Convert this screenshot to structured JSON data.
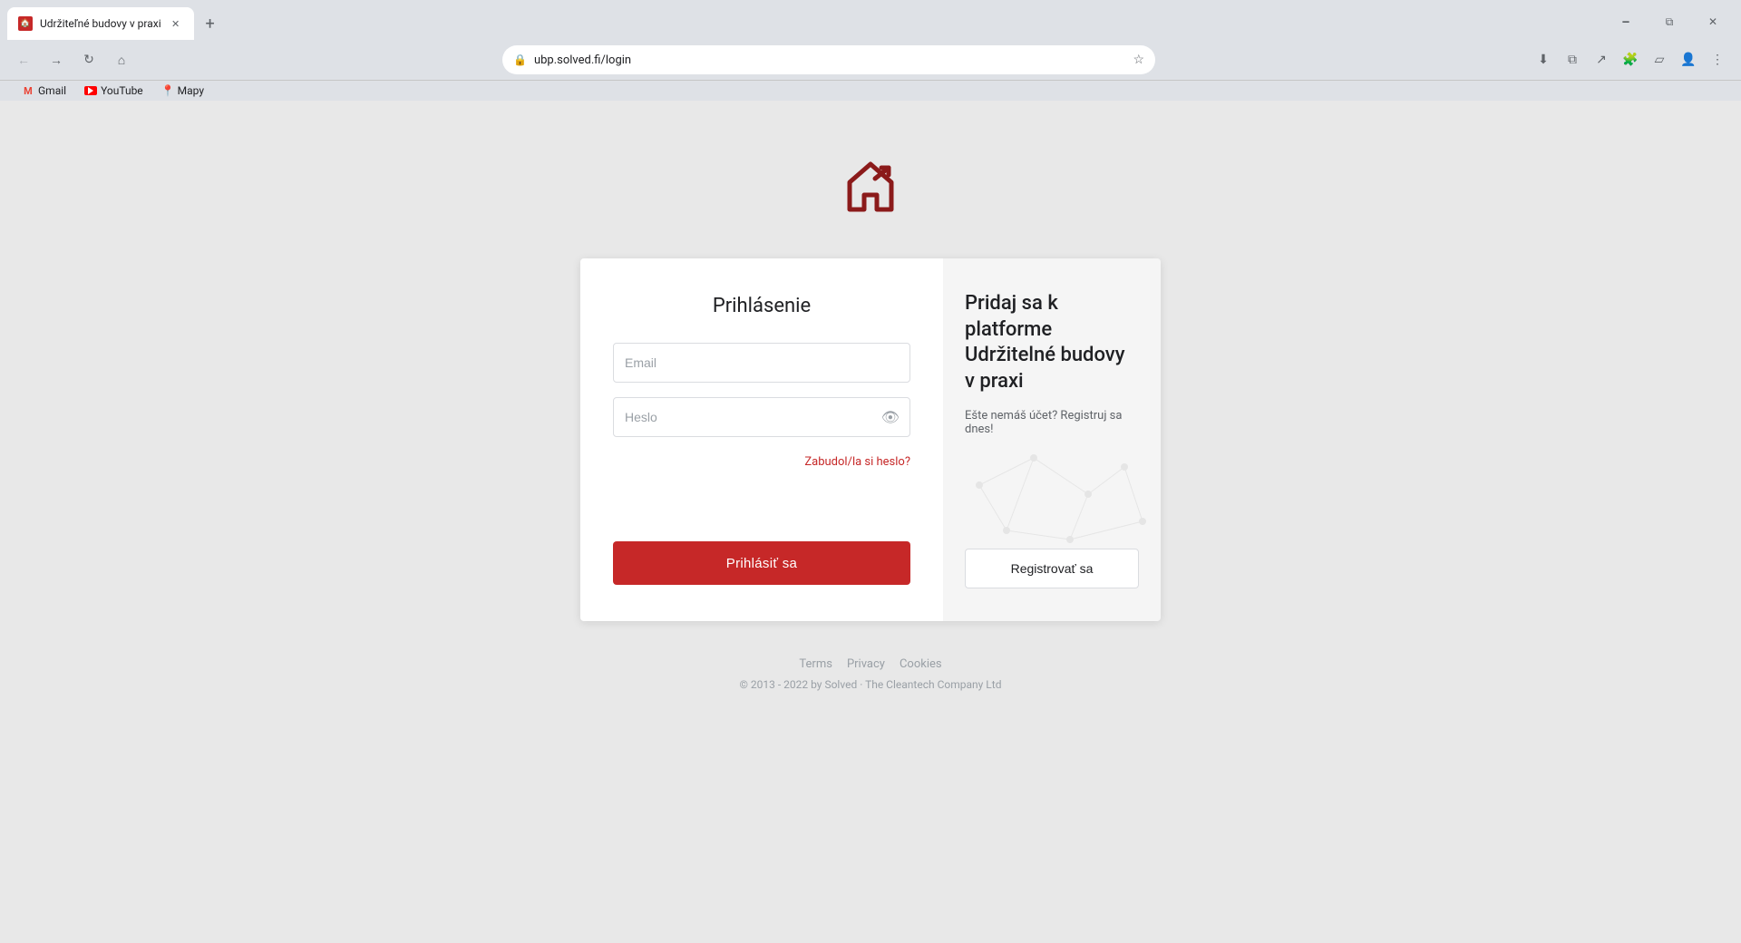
{
  "browser": {
    "tab": {
      "title": "Udržiteľné budovy v praxi",
      "favicon_color": "#c62828"
    },
    "address": "ubp.solved.fi/login",
    "bookmarks": [
      {
        "id": "gmail",
        "label": "Gmail",
        "type": "gmail"
      },
      {
        "id": "youtube",
        "label": "YouTube",
        "type": "youtube"
      },
      {
        "id": "mapy",
        "label": "Mapy",
        "type": "maps"
      }
    ],
    "window_controls": {
      "minimize": "🗕",
      "restore": "⧉",
      "close": "✕"
    }
  },
  "logo": {
    "alt": "UBP logo"
  },
  "login": {
    "title": "Prihlásenie",
    "email_placeholder": "Email",
    "password_placeholder": "Heslo",
    "forgot_label": "Zabudol/la si heslo?",
    "submit_label": "Prihlásiť sa"
  },
  "register": {
    "title": "Pridaj sa k platforme Udržitelné budovy v praxi",
    "subtitle": "Ešte nemáš účet? Registruj sa dnes!",
    "button_label": "Registrovať sa"
  },
  "footer": {
    "links": [
      {
        "id": "terms",
        "label": "Terms"
      },
      {
        "id": "privacy",
        "label": "Privacy"
      },
      {
        "id": "cookies",
        "label": "Cookies"
      }
    ],
    "copyright": "© 2013 - 2022 by Solved · The Cleantech Company Ltd"
  }
}
